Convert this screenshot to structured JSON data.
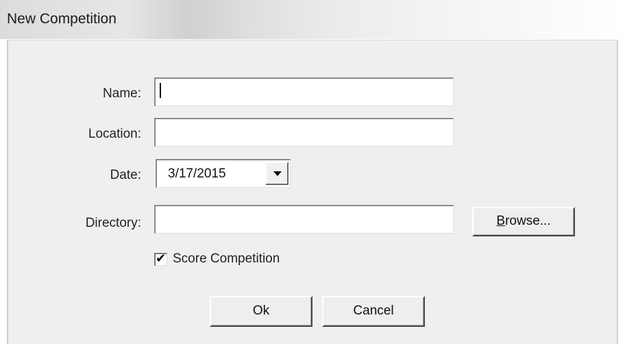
{
  "window": {
    "title": "New Competition"
  },
  "form": {
    "name_label": "Name:",
    "name_value": "",
    "location_label": "Location:",
    "location_value": "",
    "date_label": "Date:",
    "date_value": "3/17/2015",
    "directory_label": "Directory:",
    "directory_value": "",
    "browse_label_first": "B",
    "browse_label_rest": "rowse...",
    "score_checkbox_label": "Score Competition",
    "score_checked": true
  },
  "buttons": {
    "ok_label": "Ok",
    "cancel_label": "Cancel"
  },
  "icons": {
    "date_dropdown": "chevron-down-icon",
    "checkbox_mark": "check-icon"
  }
}
